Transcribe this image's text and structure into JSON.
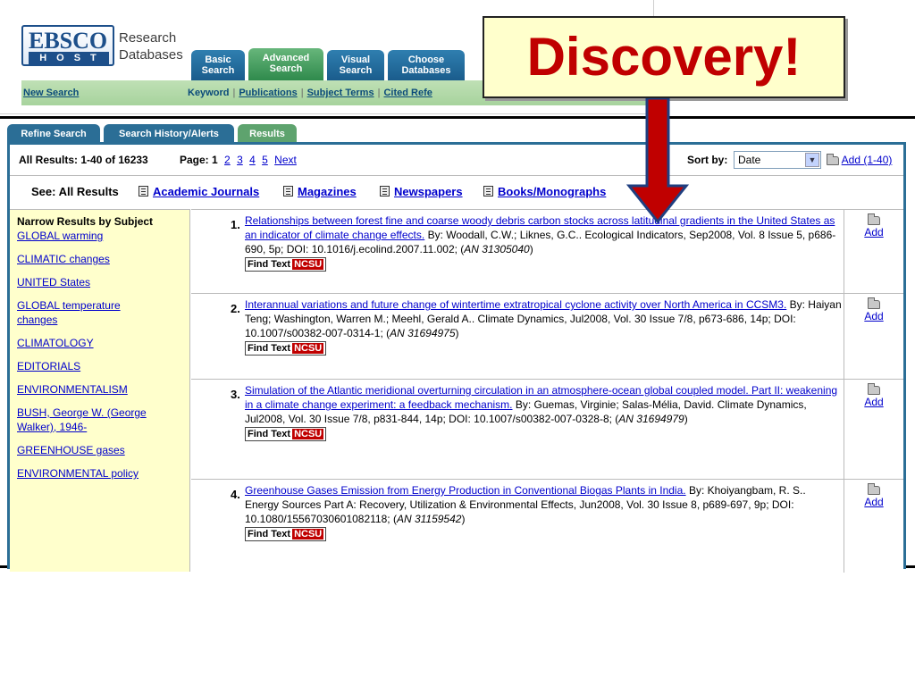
{
  "header": {
    "logo_text_top": "EBSCO",
    "logo_text_bottom": "HOST",
    "product_line1": "Research",
    "product_line2": "Databases",
    "tabs": [
      {
        "line1": "Basic",
        "line2": "Search"
      },
      {
        "line1": "Advanced",
        "line2": "Search"
      },
      {
        "line1": "Visual",
        "line2": "Search"
      },
      {
        "line1": "Choose",
        "line2": "Databases"
      }
    ],
    "new_search": "New Search",
    "links": [
      "Keyword",
      "Publications",
      "Subject Terms",
      "Cited Refe"
    ]
  },
  "callout": {
    "text": "Discovery!",
    "color": "#c00000",
    "arrow_color": "#c00000"
  },
  "result_tabs": [
    "Refine Search",
    "Search History/Alerts",
    "Results"
  ],
  "results_bar": {
    "summary": "All Results: 1-40 of 16233",
    "page_label": "Page: 1",
    "pages": [
      "2",
      "3",
      "4",
      "5"
    ],
    "next": "Next",
    "sort_label": "Sort by:",
    "sort_value": "Date",
    "add_all": "Add (1-40)"
  },
  "see_row": {
    "label": "See: All Results",
    "items": [
      "Academic Journals",
      "Magazines",
      "Newspapers",
      "Books/Monographs"
    ]
  },
  "narrow": {
    "title": "Narrow Results by Subject",
    "subjects": [
      "GLOBAL warming",
      "CLIMATIC changes",
      "UNITED States",
      "GLOBAL temperature changes",
      "CLIMATOLOGY",
      "EDITORIALS",
      "ENVIRONMENTALISM",
      "BUSH, George W. (George Walker), 1946-",
      "GREENHOUSE gases",
      "ENVIRONMENTAL policy"
    ]
  },
  "records": [
    {
      "num": "1.",
      "title": "Relationships between forest fine and coarse woody debris carbon stocks across latitudinal gradients in the United States as an indicator of climate change effects.",
      "by": " By: Woodall, C.W.; Liknes, G.C.. Ecological Indicators, Sep2008, Vol. 8 Issue 5, p686-690, 5p; DOI: 10.1016/j.ecolind.2007.11.002; (",
      "an": "AN 31305040",
      "tail": ")"
    },
    {
      "num": "2.",
      "title": "Interannual variations and future change of wintertime extratropical cyclone activity over North America in CCSM3.",
      "by": " By: Haiyan Teng; Washington, Warren M.; Meehl, Gerald A.. Climate Dynamics, Jul2008, Vol. 30 Issue 7/8, p673-686, 14p; DOI: 10.1007/s00382-007-0314-1; (",
      "an": "AN 31694975",
      "tail": ")"
    },
    {
      "num": "3.",
      "title": "Simulation of the Atlantic meridional overturning circulation in an atmosphere-ocean global coupled model. Part II: weakening in a climate change experiment: a feedback mechanism.",
      "by": " By: Guemas, Virginie; Salas-Mélia, David. Climate Dynamics, Jul2008, Vol. 30 Issue 7/8, p831-844, 14p; DOI: 10.1007/s00382-007-0328-8; (",
      "an": "AN 31694979",
      "tail": ")"
    },
    {
      "num": "4.",
      "title": "Greenhouse Gases Emission from Energy Production in Conventional Biogas Plants in India.",
      "by": " By: Khoiyangbam, R. S.. Energy Sources Part A: Recovery, Utilization & Environmental Effects, Jun2008, Vol. 30 Issue 8, p689-697, 9p; DOI: 10.1080/15567030601082118; (",
      "an": "AN 31159542",
      "tail": ")"
    }
  ],
  "findtext": {
    "label": "Find Text",
    "brand": "NCSU"
  },
  "add_label": "Add"
}
